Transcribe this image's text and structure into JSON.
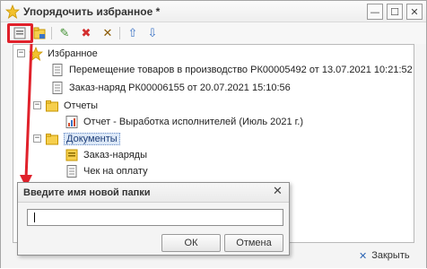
{
  "window": {
    "title": "Упорядочить избранное *",
    "min_glyph": "—",
    "max_glyph": "☐",
    "close_glyph": "✕"
  },
  "toolbar": {
    "tools": [
      {
        "name": "new-folder-icon",
        "glyph": "▭"
      },
      {
        "name": "move-to-folder-icon",
        "glyph": "▰"
      },
      {
        "name": "edit-pencil-icon",
        "glyph": "✎"
      },
      {
        "name": "delete-icon",
        "glyph": "✖"
      },
      {
        "name": "clear-icon",
        "glyph": "✕"
      },
      {
        "name": "move-up-icon",
        "glyph": "⇧"
      },
      {
        "name": "move-down-icon",
        "glyph": "⇩"
      }
    ],
    "colors": {
      "accent_red": "#e0212b",
      "pencil": "#3f8f2f",
      "delete": "#d32f2f",
      "clear": "#8b5a00",
      "arrow": "#3b73c5"
    }
  },
  "tree": {
    "root": "Избранное",
    "items": [
      {
        "label": "Перемещение товаров в производство РК00005492 от 13.07.2021 10:21:52"
      },
      {
        "label": "Заказ-наряд РК00006155 от 20.07.2021 15:10:56"
      }
    ],
    "reports_folder": "Отчеты",
    "report_item": "Отчет - Выработка исполнителей (Июль 2021 г.)",
    "documents_folder": "Документы",
    "documents_children": [
      "Заказ-наряды",
      "Чек на оплату"
    ]
  },
  "dialog": {
    "title": "Введите имя новой папки",
    "close_glyph": "✕",
    "input_value": "",
    "ok_label": "ОК",
    "cancel_label": "Отмена"
  },
  "footer": {
    "close_label": "Закрыть",
    "close_glyph": "✕"
  }
}
